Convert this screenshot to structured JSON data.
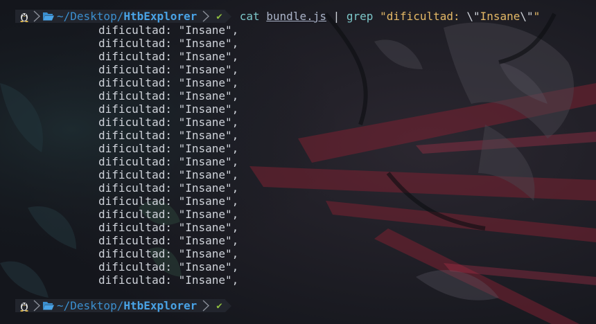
{
  "colors": {
    "background": "#14161c",
    "prompt_segment": "#22252d",
    "path": "#3b8fcf",
    "command": "#7cc6c9",
    "string": "#e4b866",
    "output_text": "#cfd3da",
    "status_ok": "#8fbf3f",
    "wallpaper_accent": "#b5324a"
  },
  "prompt": {
    "os_icon": "linux-tux-icon",
    "folder_icon": "folder-open-icon",
    "path_prefix": "~/Desktop/",
    "path_leaf": "HtbExplorer",
    "status_icon": "check-icon",
    "status_symbol": "✔"
  },
  "command": {
    "bin": "cat",
    "arg": "bundle.js",
    "pipe": "|",
    "grep": "grep",
    "pattern_open": "\"dificultad: ",
    "escape_open": "\\\"",
    "pattern_word": "Insane",
    "escape_close": "\\\"",
    "pattern_close": "\""
  },
  "output_lines": [
    "dificultad: \"Insane\",",
    "dificultad: \"Insane\",",
    "dificultad: \"Insane\",",
    "dificultad: \"Insane\",",
    "dificultad: \"Insane\",",
    "dificultad: \"Insane\",",
    "dificultad: \"Insane\",",
    "dificultad: \"Insane\",",
    "dificultad: \"Insane\",",
    "dificultad: \"Insane\",",
    "dificultad: \"Insane\",",
    "dificultad: \"Insane\",",
    "dificultad: \"Insane\",",
    "dificultad: \"Insane\",",
    "dificultad: \"Insane\",",
    "dificultad: \"Insane\",",
    "dificultad: \"Insane\",",
    "dificultad: \"Insane\",",
    "dificultad: \"Insane\",",
    "dificultad: \"Insane\","
  ]
}
